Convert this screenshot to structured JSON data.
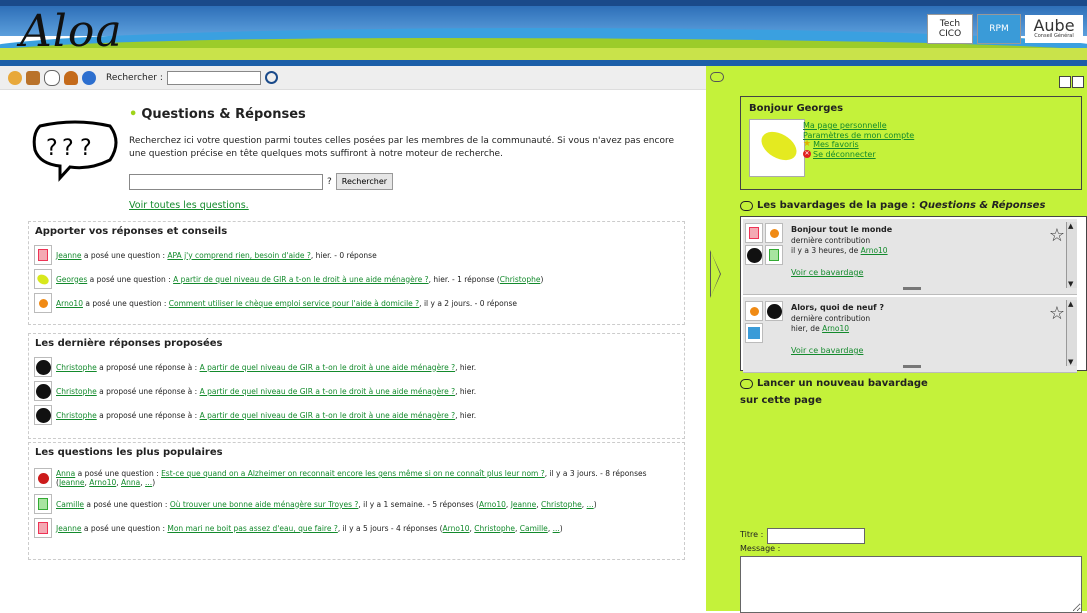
{
  "header": {
    "logo": "Aloa",
    "partners": [
      "Tech",
      "CICO",
      "RPM",
      "Aube",
      "Conseil Général"
    ]
  },
  "toolbar": {
    "icons": [
      "users-icon",
      "book-icon",
      "questions-icon",
      "chat-icon",
      "info-icon"
    ],
    "search_label": "Rechercher :",
    "search_value": ""
  },
  "main": {
    "title": "Questions & Réponses",
    "intro": "Recherchez ici votre question parmi toutes celles posées par les membres de la communauté. Si vous n'avez pas encore une question précise en tête quelques mots suffiront à notre moteur de recherche.",
    "search_button": "Rechercher",
    "search_suffix": "?",
    "see_all": "Voir toutes les questions.",
    "sections": [
      {
        "title": "Apporter vos réponses et conseils",
        "rows": [
          {
            "user": "Jeanne",
            "verb": " a posé une question : ",
            "link": "APA j'y comprend rien, besoin d'aide ?",
            "after": ", hier. - 0 réponse",
            "extra": [],
            "avatar": "gift"
          },
          {
            "user": "Georges",
            "verb": " a posé une question : ",
            "link": "A partir de quel niveau de GIR a t-on le droit à une aide ménagère ?",
            "after": ", hier. - 1 réponse (",
            "extra": [
              "Christophe"
            ],
            "close": ")",
            "avatar": "lime"
          },
          {
            "user": "Arno10",
            "verb": " a posé une question : ",
            "link": "Comment utiliser le chèque emploi service pour l'aide à domicile ?",
            "after": ", il y a 2 jours. - 0 réponse",
            "extra": [],
            "avatar": "orange"
          }
        ]
      },
      {
        "title": "Les dernière réponses proposées",
        "rows": [
          {
            "user": "Christophe",
            "verb": " a proposé une réponse à : ",
            "link": "A partir de quel niveau de GIR a t-on le droit à une aide ménagère ?",
            "after": ", hier.",
            "extra": [],
            "avatar": "black"
          },
          {
            "user": "Christophe",
            "verb": " a proposé une réponse à : ",
            "link": "A partir de quel niveau de GIR a t-on le droit à une aide ménagère ?",
            "after": ", hier.",
            "extra": [],
            "avatar": "black"
          },
          {
            "user": "Christophe",
            "verb": " a proposé une réponse à : ",
            "link": "A partir de quel niveau de GIR a t-on le droit à une aide ménagère ?",
            "after": ", hier.",
            "extra": [],
            "avatar": "black"
          }
        ]
      },
      {
        "title": "Les questions les plus populaires",
        "rows": [
          {
            "user": "Anna",
            "verb": " a posé une question : ",
            "link": "Est-ce que quand on a Alzheimer on reconnait encore les gens même si on ne connaît plus leur nom ?",
            "after": ", il y a 3 jours. - 8 réponses (",
            "extra": [
              "Jeanne",
              "Arno10",
              "Anna",
              "..."
            ],
            "close": ")",
            "avatar": "red"
          },
          {
            "user": "Camille",
            "verb": " a posé une question : ",
            "link": "Où trouver une bonne aide ménagère sur Troyes ?",
            "after": ", il y a 1 semaine. - 5 réponses (",
            "extra": [
              "Arno10",
              "Jeanne",
              "Christophe",
              "..."
            ],
            "close": ")",
            "avatar": "giftg"
          },
          {
            "user": "Jeanne",
            "verb": " a posé une question : ",
            "link": "Mon mari ne boit pas assez d'eau, que faire ?",
            "after": ", il y a 5 jours - 4 réponses (",
            "extra": [
              "Arno10",
              "Christophe",
              "Camille",
              "..."
            ],
            "close": ")",
            "avatar": "gift"
          }
        ]
      }
    ]
  },
  "profile": {
    "greeting": "Bonjour Georges",
    "links": [
      "Ma page personnelle",
      "Paramètres de mon compte",
      "Mes favoris",
      "Se déconnecter"
    ]
  },
  "chats": {
    "title_prefix": "Les bavardages de la page : ",
    "title_page": "Questions & Réponses",
    "items": [
      {
        "title": "Bonjour tout le monde",
        "label": "dernière contribution",
        "when": "il y a 3 heures, de ",
        "by": "Arno10",
        "link": "Voir ce bavardage"
      },
      {
        "title": "Alors, quoi de neuf ?",
        "label": "dernière contribution",
        "when": "hier, de ",
        "by": "Arno10",
        "link": "Voir ce bavardage"
      }
    ]
  },
  "new_chat": {
    "title": "Lancer un nouveau bavardage",
    "subtitle": "sur cette page",
    "titre_label": "Titre :",
    "message_label": "Message :"
  }
}
